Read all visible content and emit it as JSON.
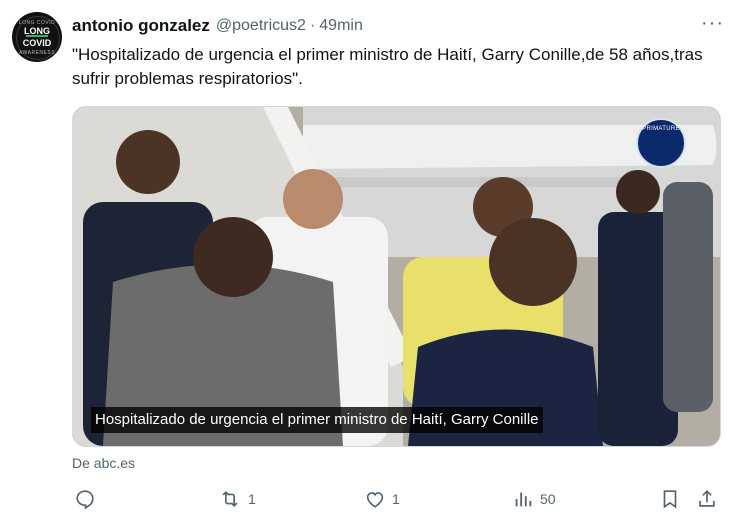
{
  "author": {
    "display_name": "antonio gonzalez",
    "handle": "@poetricus2",
    "separator": "·",
    "time": "49min",
    "avatar": {
      "line1": "LONG",
      "line2": "COVID",
      "small_top": "LONG COVID",
      "small_bottom": "AWARENESS"
    }
  },
  "tweet": {
    "text": "\"Hospitalizado de urgencia el primer ministro de Haití, Garry Conille,de 58 años,tras sufrir problemas respiratorios\"."
  },
  "media": {
    "caption": "Hospitalizado de urgencia el primer ministro de Haití, Garry Conille",
    "seal_text": "PRIMATURE"
  },
  "card": {
    "source": "De abc.es"
  },
  "actions": {
    "reply_count": "",
    "retweet_count": "1",
    "like_count": "1",
    "view_count": "50"
  },
  "more_label": "···",
  "colors": {
    "text": "#0f1419",
    "secondary": "#536471",
    "border": "#cfd9de",
    "background": "#ffffff"
  }
}
